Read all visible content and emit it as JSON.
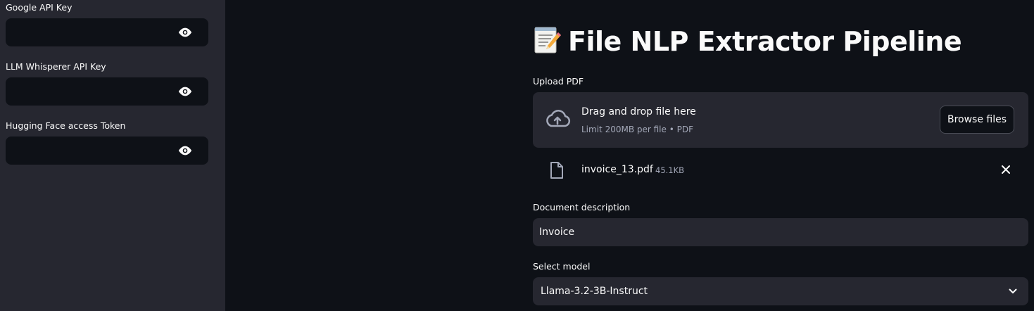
{
  "sidebar": {
    "fields": [
      {
        "label": "Google API Key",
        "icon": "eye-icon"
      },
      {
        "label": "LLM Whisperer API Key",
        "icon": "eye-icon"
      },
      {
        "label": "Hugging Face access Token",
        "icon": "eye-icon"
      }
    ]
  },
  "main": {
    "title": "File NLP Extractor Pipeline",
    "title_icon": "memo-icon",
    "upload": {
      "label": "Upload PDF",
      "drop_title": "Drag and drop file here",
      "drop_subtitle": "Limit 200MB per file • PDF",
      "browse_label": "Browse files",
      "file": {
        "name": "invoice_13.pdf",
        "size": "45.1KB"
      }
    },
    "description": {
      "label": "Document description",
      "value": "Invoice"
    },
    "model": {
      "label": "Select model",
      "value": "Llama-3.2-3B-Instruct"
    }
  },
  "colors": {
    "background": "#0e1117",
    "sidebar": "#262730",
    "input": "#262730",
    "muted_text": "#a3a8b8"
  }
}
